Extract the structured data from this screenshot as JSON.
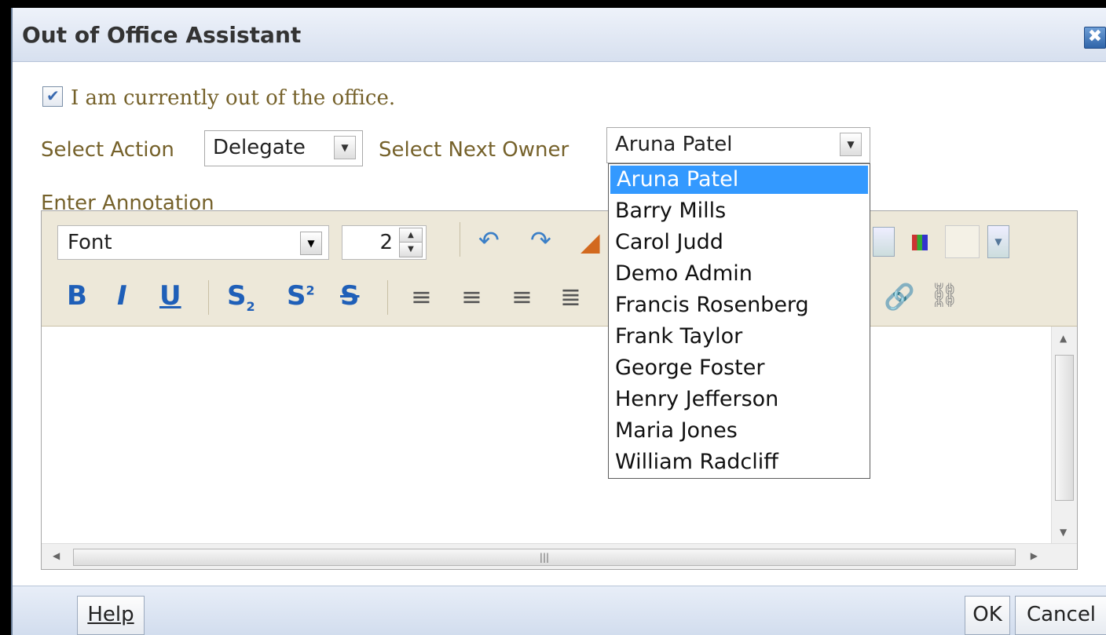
{
  "dialog": {
    "title": "Out of Office Assistant",
    "close_glyph": "✖"
  },
  "out_of_office": {
    "checked": true,
    "label": "I am currently out of the office."
  },
  "action": {
    "label": "Select Action",
    "value": "Delegate"
  },
  "owner": {
    "label": "Select Next Owner",
    "value": "Aruna Patel",
    "options": [
      "Aruna Patel",
      "Barry Mills",
      "Carol Judd",
      "Demo Admin",
      "Francis Rosenberg",
      "Frank Taylor",
      "George Foster",
      "Henry Jefferson",
      "Maria Jones",
      "William Radcliff"
    ],
    "highlighted": "Aruna Patel"
  },
  "annotation": {
    "label": "Enter Annotation",
    "font_value": "Font",
    "size_value": "2"
  },
  "footer": {
    "help_label": "Help",
    "ok_label": "OK",
    "cancel_label": "Cancel"
  },
  "icons": [
    "undo-icon",
    "redo-icon",
    "eraser-icon",
    "bold-icon",
    "italic-icon",
    "underline-icon",
    "subscript-icon",
    "superscript-icon",
    "strikethrough-icon",
    "align-left-icon",
    "align-center-icon",
    "align-right-icon",
    "justify-icon",
    "link-icon",
    "unlink-icon",
    "color-grid-icon"
  ]
}
